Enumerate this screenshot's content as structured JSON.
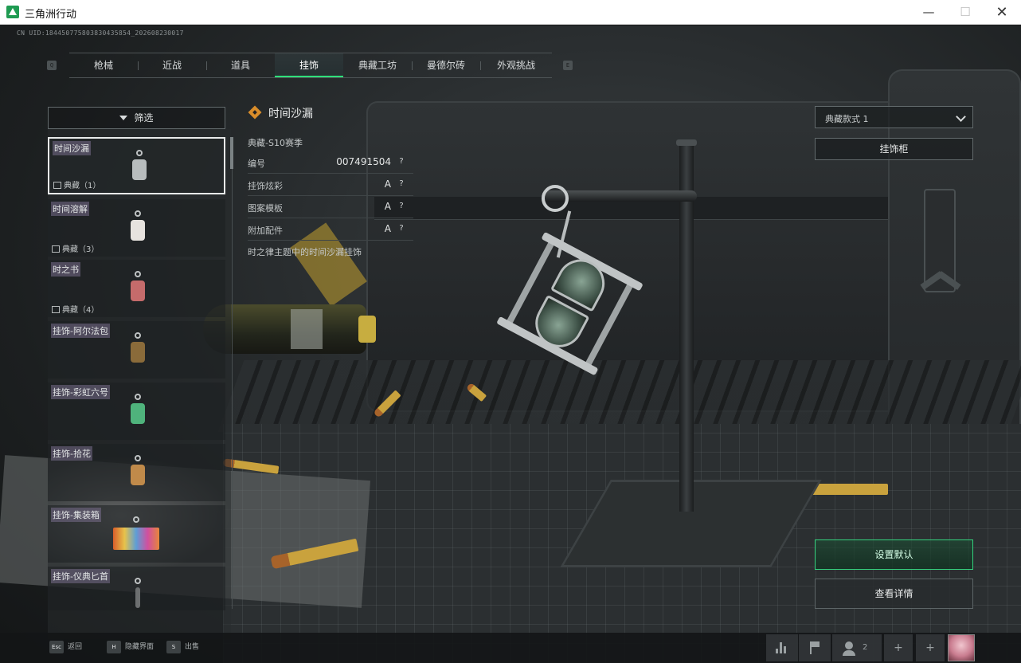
{
  "window": {
    "title": "三角洲行动",
    "minimize_glyph": "—",
    "maximize_glyph": "☐",
    "close_glyph": "✕"
  },
  "hud": {
    "uid": "CN UID:18445077580383043585​4_202608230017"
  },
  "tabs": {
    "prev_key": "Q",
    "next_key": "E",
    "items": [
      {
        "label": "枪械"
      },
      {
        "label": "近战"
      },
      {
        "label": "道具"
      },
      {
        "label": "挂饰"
      },
      {
        "label": "典藏工坊"
      },
      {
        "label": "曼德尔砖"
      },
      {
        "label": "外观挑战"
      }
    ],
    "active_index": 3,
    "accent_color": "#2ee07a"
  },
  "filter": {
    "label": "筛选",
    "icon": "funnel-icon"
  },
  "list": {
    "items": [
      {
        "name": "时间沙漏",
        "rarity": "典藏（1）",
        "selected": true,
        "color": "#b7bcbd"
      },
      {
        "name": "时间溶解",
        "rarity": "典藏（3）",
        "color": "#e7e3df"
      },
      {
        "name": "时之书",
        "rarity": "典藏（4）",
        "color": "#c56b6b"
      },
      {
        "name": "挂饰-阿尔法包",
        "rarity": "",
        "color": "#8a6b3a"
      },
      {
        "name": "挂饰-彩虹六号",
        "rarity": "",
        "color": "#4fb37c"
      },
      {
        "name": "挂饰-拾花",
        "rarity": "",
        "color": "#c08a4a"
      },
      {
        "name": "挂饰-集装箱",
        "rarity": "",
        "color": "#e08a36"
      },
      {
        "name": "挂饰-仪典匕首",
        "rarity": "",
        "color": "#6c6f70"
      }
    ]
  },
  "detail": {
    "title": "时间沙漏",
    "season": "典藏-S10赛季",
    "properties": [
      {
        "label": "编号",
        "value": "007491504"
      },
      {
        "label": "挂饰炫彩",
        "value": "A"
      },
      {
        "label": "图案模板",
        "value": "A"
      },
      {
        "label": "附加配件",
        "value": "A"
      }
    ],
    "help_glyph": "?",
    "description": "时之律主题中的时间沙漏挂饰",
    "icon_color": "#d98d2a"
  },
  "right": {
    "style_select": "典藏款式 1",
    "cabinet_button": "挂饰柜",
    "set_default_button": "设置默认",
    "view_details_button": "查看详情"
  },
  "bottom": {
    "hints": [
      {
        "key": "Esc",
        "label": "返回"
      },
      {
        "key": "H",
        "label": "隐藏界面"
      },
      {
        "key": "S",
        "label": "出售"
      }
    ],
    "friends_count": "2",
    "plus_glyph": "+"
  }
}
